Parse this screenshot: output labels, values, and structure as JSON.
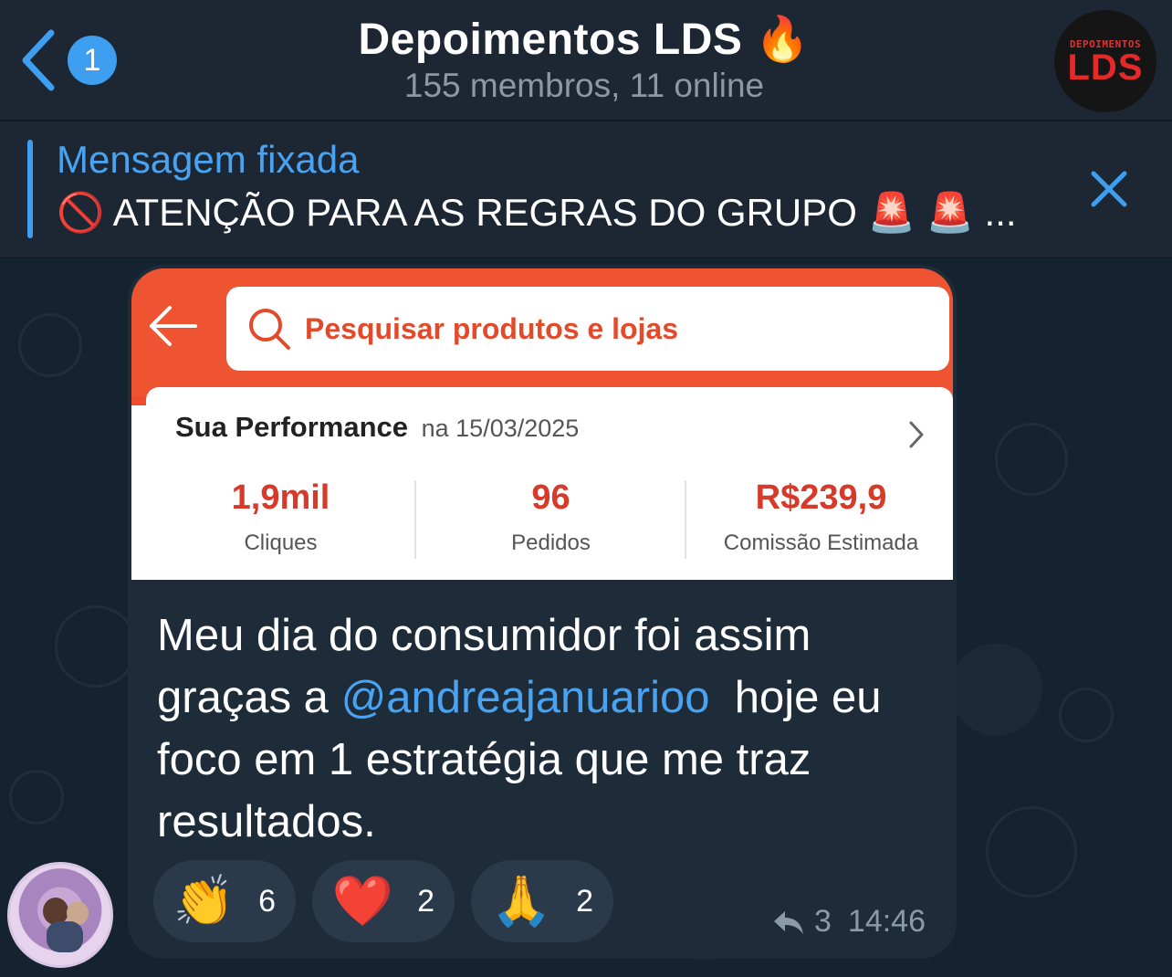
{
  "header": {
    "back_badge": "1",
    "title": "Depoimentos LDS 🔥",
    "subtitle": "155 membros, 11 online",
    "avatar_top": "DEPOIMENTOS",
    "avatar_main": "LDS"
  },
  "pinned": {
    "title": "Mensagem fixada",
    "text": "🚫 ATENÇÃO PARA AS REGRAS DO GRUPO 🚨 🚨 ..."
  },
  "message": {
    "screenshot": {
      "search_placeholder": "Pesquisar produtos e lojas",
      "performance_title": "Sua Performance",
      "performance_date": "na 15/03/2025",
      "stats": [
        {
          "value": "1,9mil",
          "label": "Cliques"
        },
        {
          "value": "96",
          "label": "Pedidos"
        },
        {
          "value": "R$239,9",
          "label": "Comissão Estimada"
        }
      ]
    },
    "text_before": "Meu dia do consumidor foi assim graças a ",
    "mention": "@andreajanuarioo",
    "text_after": "  hoje eu foco em 1 estratégia que me traz resultados.",
    "reactions": [
      {
        "emoji": "👏",
        "count": "6"
      },
      {
        "emoji": "❤️",
        "count": "2"
      },
      {
        "emoji": "🙏",
        "count": "2"
      }
    ],
    "replies": "3",
    "time": "14:46"
  },
  "colors": {
    "accent": "#3e9ff0",
    "header_bg": "#1c2733",
    "bubble_bg": "#1e2c3a",
    "shopee_orange": "#ee4d2d"
  }
}
